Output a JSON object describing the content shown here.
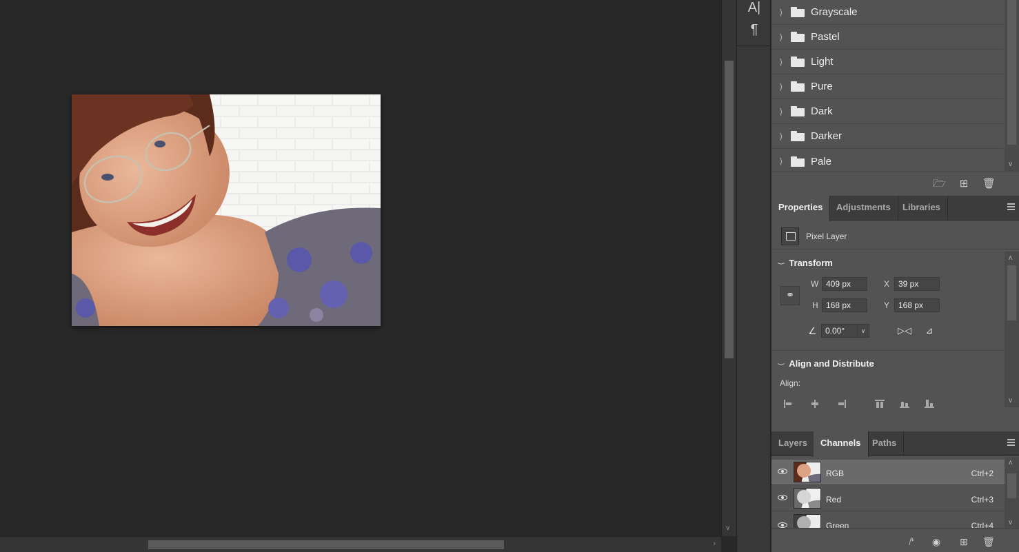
{
  "toolstrip": {
    "type_tool_icon": "A|",
    "paragraph_icon": "¶"
  },
  "swatches": {
    "folders": [
      {
        "label": "Grayscale"
      },
      {
        "label": "Pastel"
      },
      {
        "label": "Light"
      },
      {
        "label": "Pure"
      },
      {
        "label": "Dark"
      },
      {
        "label": "Darker"
      },
      {
        "label": "Pale"
      }
    ],
    "footer_icons": [
      "new-group-icon",
      "new-swatch-icon",
      "trash-icon"
    ]
  },
  "properties_tabs": {
    "tabs": [
      {
        "label": "Properties",
        "active": true
      },
      {
        "label": "Adjustments",
        "active": false
      },
      {
        "label": "Libraries",
        "active": false
      }
    ]
  },
  "properties": {
    "layer_type": "Pixel Layer",
    "transform": {
      "title": "Transform",
      "w_label": "W",
      "w_value": "409 px",
      "h_label": "H",
      "h_value": "168 px",
      "x_label": "X",
      "x_value": "39 px",
      "y_label": "Y",
      "y_value": "168 px",
      "angle_value": "0.00°"
    },
    "align": {
      "title": "Align and Distribute",
      "align_label": "Align:"
    }
  },
  "layers_tabs": {
    "tabs": [
      {
        "label": "Layers",
        "active": false
      },
      {
        "label": "Channels",
        "active": true
      },
      {
        "label": "Paths",
        "active": false
      }
    ]
  },
  "channels": [
    {
      "name": "RGB",
      "shortcut": "Ctrl+2",
      "selected": true
    },
    {
      "name": "Red",
      "shortcut": "Ctrl+3",
      "selected": false
    },
    {
      "name": "Green",
      "shortcut": "Ctrl+4",
      "selected": false
    }
  ],
  "colors": {
    "canvas_bg": "#282828",
    "panel_bg": "#535353",
    "tab_bar_bg": "#3c3c3c",
    "selected_row": "#6a6a6a"
  }
}
